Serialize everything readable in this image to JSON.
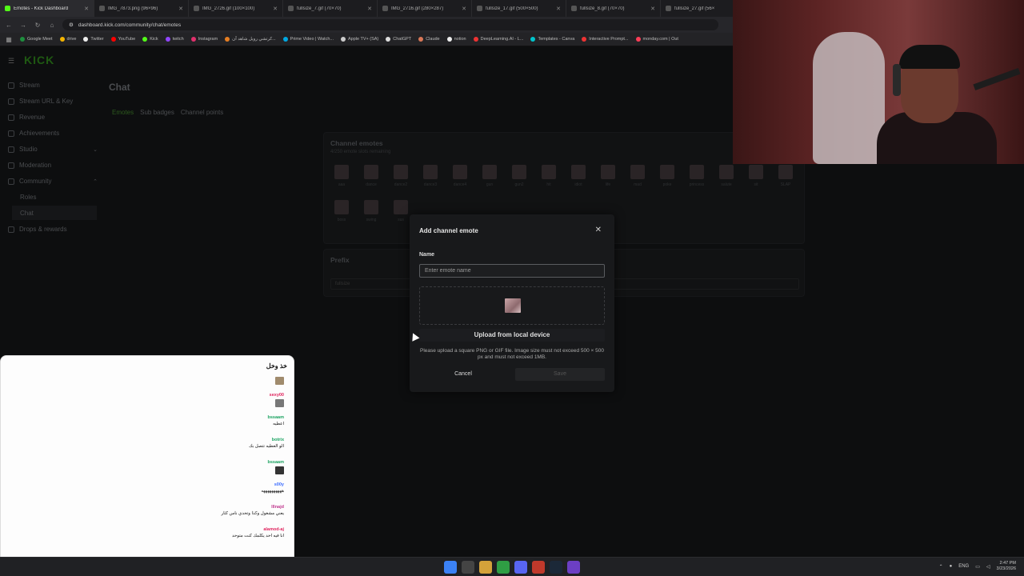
{
  "browser": {
    "tabs": [
      {
        "title": "Emotes - Kick Dashboard",
        "active": true
      },
      {
        "title": "IMG_7873.png (96×96)"
      },
      {
        "title": "IMG_2726.gif (100×100)"
      },
      {
        "title": "fullsize_7.gif (70×70)"
      },
      {
        "title": "IMG_2716.gif (280×287)"
      },
      {
        "title": "fullsize_17.gif (500×500)"
      },
      {
        "title": "fullsize_8.gif (70×70)"
      },
      {
        "title": "fullsize_27.gif (56×"
      }
    ],
    "url": "dashboard.kick.com/community/chat/emotes",
    "bookmarks": [
      "Google Meet",
      "drive",
      "Twitter",
      "YouTube",
      "Kick",
      "twitch",
      "Instagram",
      "كرتشي رويل شاهد آن...",
      "Prime Video | Watch...",
      "Apple TV+ (SA)",
      "ChatGPT",
      "Claude",
      "notion",
      "DeepLearning.AI - L...",
      "Templates - Canva",
      "Interactive Prompt...",
      "monday.com | Out"
    ]
  },
  "sidebar": {
    "logo": "KICK",
    "items": [
      {
        "label": "Stream"
      },
      {
        "label": "Stream URL & Key"
      },
      {
        "label": "Revenue"
      },
      {
        "label": "Achievements"
      },
      {
        "label": "Studio",
        "chevron": "⌄"
      },
      {
        "label": "Moderation"
      },
      {
        "label": "Community",
        "chevron": "⌃"
      },
      {
        "label": "Roles"
      },
      {
        "label": "Chat"
      },
      {
        "label": "Drops & rewards"
      }
    ]
  },
  "main": {
    "title": "Chat",
    "tabs": [
      "Emotes",
      "Sub badges",
      "Channel points"
    ],
    "channel_emotes": {
      "title": "Channel emotes",
      "subtitle": "4/250 emote slots remaining",
      "emotes": [
        "aaa",
        "dance",
        "dance2",
        "dance3",
        "dance4",
        "gun",
        "gun2",
        "hit",
        "idiot",
        "life",
        "mad",
        "poke",
        "princess",
        "salute",
        "sit",
        "SLAP",
        "boss",
        "swing",
        "sus"
      ]
    },
    "prefix": {
      "title": "Prefix",
      "value": "fullsize"
    }
  },
  "modal": {
    "title": "Add channel emote",
    "name_label": "Name",
    "name_placeholder": "Enter emote name",
    "upload_label": "Upload from local device",
    "help_text": "Please upload a square PNG or GIF file. Image size must not exceed 500 × 500 px and must not exceed 1MB.",
    "cancel_label": "Cancel",
    "save_label": "Save"
  },
  "chat": {
    "header": "خذ وخل",
    "messages": [
      {
        "user": "",
        "text": "",
        "emoji": true
      },
      {
        "user": "sexy00",
        "text": "",
        "emoji": true,
        "color": "#e0245e"
      },
      {
        "user": "bssaam",
        "text": "اعطيه",
        "color": "#1aa260"
      },
      {
        "user": "botrix",
        "text": "الو العطيه تتصل بك",
        "color": "#1aa260"
      },
      {
        "user": "bssaam",
        "text": "",
        "emoji": true,
        "color": "#1aa260"
      },
      {
        "user": "s00y",
        "text": "ههههههههههه",
        "color": "#3b6cff"
      },
      {
        "user": "lllnajd",
        "text": "يعني مشغول وكذا وتحدي ناس كثار",
        "color": "#c0398f"
      },
      {
        "user": "alamod-aj",
        "text": "انا فيه احد يكلمك كنت متوحد",
        "color": "#e0245e"
      }
    ]
  },
  "taskbar": {
    "lang": "ENG",
    "time": "2:47 PM",
    "date": "3/23/2026"
  }
}
